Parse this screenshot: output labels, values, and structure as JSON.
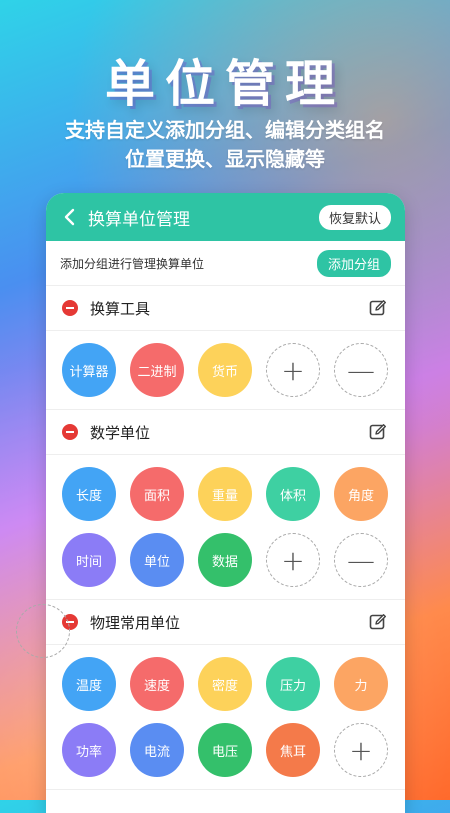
{
  "hero": {
    "title": "单位管理",
    "subtitle_line1": "支持自定义添加分组、编辑分类组名",
    "subtitle_line2": "位置更换、显示隐藏等"
  },
  "app": {
    "title": "换算单位管理",
    "reset_label": "恢复默认",
    "add_hint": "添加分组进行管理换算单位",
    "add_group_label": "添加分组"
  },
  "colors": {
    "primary": "#2ec4a4",
    "blue": "#43a4f5",
    "red": "#f56b6b",
    "yellow": "#fdd25a",
    "green": "#3ed0a2",
    "orange": "#fca563",
    "purple": "#8b7cf6",
    "royal": "#5a8df2",
    "leaf": "#34c06b",
    "vermilion": "#f47a4a"
  },
  "groups": [
    {
      "title": "换算工具",
      "chips": [
        {
          "label": "计算器",
          "color": "#43a4f5"
        },
        {
          "label": "二进制",
          "color": "#f56b6b"
        },
        {
          "label": "货币",
          "color": "#fdd25a"
        }
      ],
      "add_symbol": "+",
      "remove_symbol": "—"
    },
    {
      "title": "数学单位",
      "chips": [
        {
          "label": "长度",
          "color": "#43a4f5"
        },
        {
          "label": "面积",
          "color": "#f56b6b"
        },
        {
          "label": "重量",
          "color": "#fdd25a"
        },
        {
          "label": "体积",
          "color": "#3ed0a2"
        },
        {
          "label": "角度",
          "color": "#fca563"
        },
        {
          "label": "时间",
          "color": "#8b7cf6"
        },
        {
          "label": "单位",
          "color": "#5a8df2"
        },
        {
          "label": "数据",
          "color": "#34c06b"
        }
      ],
      "add_symbol": "+",
      "remove_symbol": "—"
    },
    {
      "title": "物理常用单位",
      "chips": [
        {
          "label": "温度",
          "color": "#43a4f5"
        },
        {
          "label": "速度",
          "color": "#f56b6b"
        },
        {
          "label": "密度",
          "color": "#fdd25a"
        },
        {
          "label": "压力",
          "color": "#3ed0a2"
        },
        {
          "label": "力",
          "color": "#fca563"
        },
        {
          "label": "功率",
          "color": "#8b7cf6"
        },
        {
          "label": "电流",
          "color": "#5a8df2"
        },
        {
          "label": "电压",
          "color": "#34c06b"
        },
        {
          "label": "焦耳",
          "color": "#f47a4a"
        }
      ],
      "add_symbol": "+"
    }
  ]
}
